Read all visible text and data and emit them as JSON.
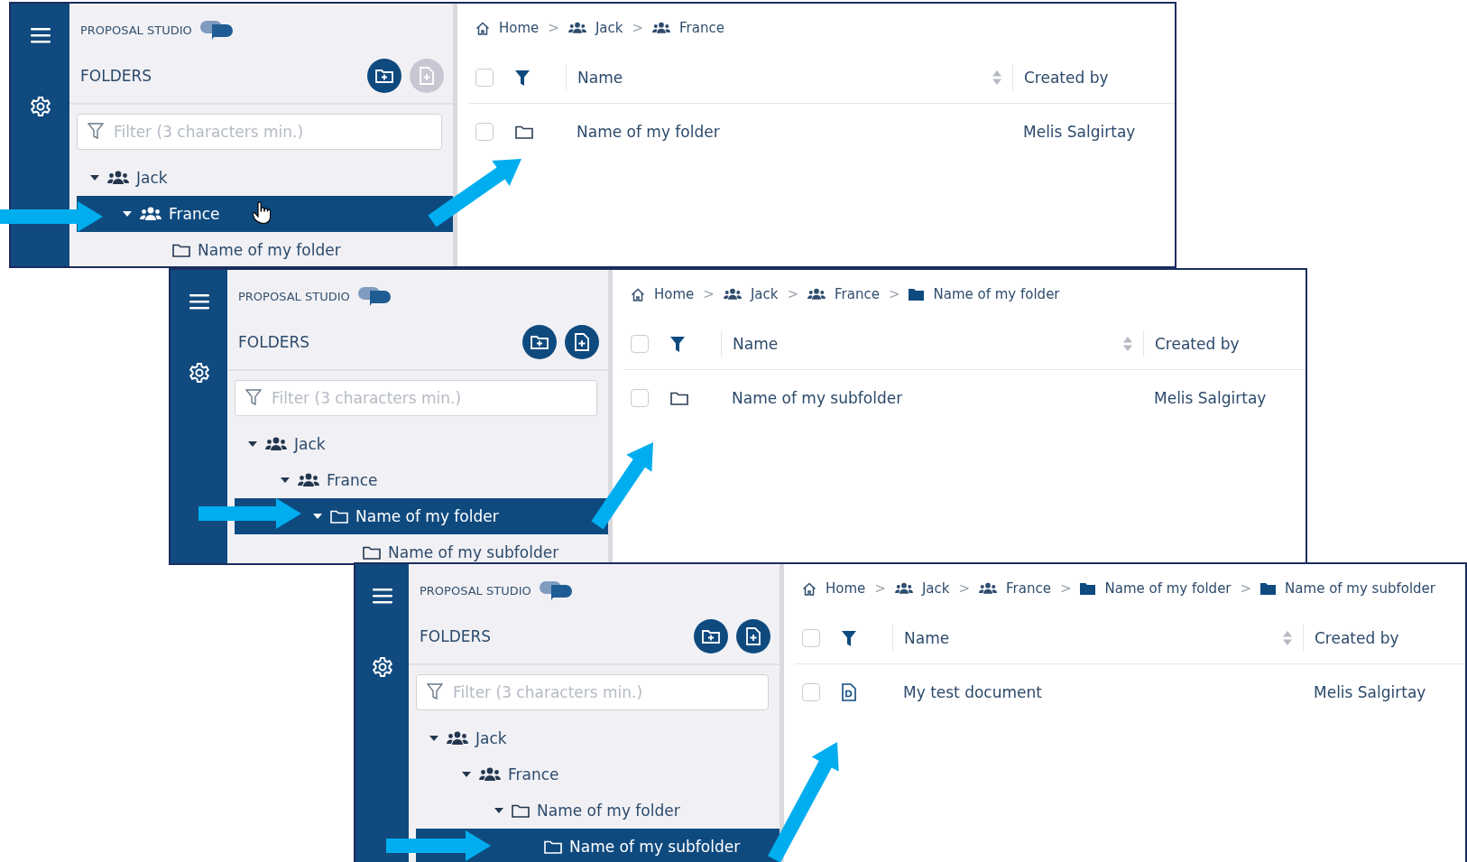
{
  "panels": [
    {
      "app_name": "PROPOSAL STUDIO",
      "section_title": "FOLDERS",
      "actions": [
        {
          "kind": "new-folder",
          "disabled": false
        },
        {
          "kind": "new-document",
          "disabled": true
        }
      ],
      "filter": {
        "placeholder": "Filter (3 characters min.)"
      },
      "tree": [
        {
          "label": "Jack",
          "kind": "group",
          "expanded": true,
          "selected": false,
          "children": [
            {
              "label": "France",
              "kind": "group",
              "expanded": true,
              "selected": true,
              "pointer": true,
              "children": [
                {
                  "label": "Name of my folder",
                  "kind": "folder",
                  "selected": false
                }
              ]
            }
          ]
        }
      ],
      "breadcrumb": [
        {
          "label": "Home",
          "kind": "home"
        },
        {
          "sep": ">",
          "label": "Jack",
          "kind": "group"
        },
        {
          "sep": ">",
          "label": "France",
          "kind": "group"
        }
      ],
      "columns": [
        "Name",
        "Created by"
      ],
      "all_checked": false,
      "rows": [
        {
          "kind": "folder",
          "name": "Name of my folder",
          "created_by": "Melis Salgirtay",
          "checked": false
        }
      ]
    },
    {
      "app_name": "PROPOSAL STUDIO",
      "section_title": "FOLDERS",
      "actions": [
        {
          "kind": "new-folder",
          "disabled": false
        },
        {
          "kind": "new-document",
          "disabled": false
        }
      ],
      "filter": {
        "placeholder": "Filter (3 characters min.)"
      },
      "tree": [
        {
          "label": "Jack",
          "kind": "group",
          "expanded": true,
          "selected": false,
          "children": [
            {
              "label": "France",
              "kind": "group",
              "expanded": true,
              "selected": false,
              "children": [
                {
                  "label": "Name of my folder",
                  "kind": "folder",
                  "expanded": true,
                  "selected": true,
                  "children": [
                    {
                      "label": "Name of my subfolder",
                      "kind": "folder",
                      "selected": false
                    }
                  ]
                }
              ]
            }
          ]
        }
      ],
      "breadcrumb": [
        {
          "label": "Home",
          "kind": "home"
        },
        {
          "sep": ">",
          "label": "Jack",
          "kind": "group"
        },
        {
          "sep": ">",
          "label": "France",
          "kind": "group"
        },
        {
          "sep": ">",
          "label": "Name of my folder",
          "kind": "folder"
        }
      ],
      "columns": [
        "Name",
        "Created by"
      ],
      "all_checked": false,
      "rows": [
        {
          "kind": "folder",
          "name": "Name of my subfolder",
          "created_by": "Melis Salgirtay",
          "checked": false
        }
      ]
    },
    {
      "app_name": "PROPOSAL STUDIO",
      "section_title": "FOLDERS",
      "actions": [
        {
          "kind": "new-folder",
          "disabled": false
        },
        {
          "kind": "new-document",
          "disabled": false
        }
      ],
      "filter": {
        "placeholder": "Filter (3 characters min.)"
      },
      "tree": [
        {
          "label": "Jack",
          "kind": "group",
          "expanded": true,
          "selected": false,
          "children": [
            {
              "label": "France",
              "kind": "group",
              "expanded": true,
              "selected": false,
              "children": [
                {
                  "label": "Name of my folder",
                  "kind": "folder",
                  "expanded": true,
                  "selected": false,
                  "children": [
                    {
                      "label": "Name of my subfolder",
                      "kind": "folder",
                      "selected": true
                    }
                  ]
                }
              ]
            }
          ]
        }
      ],
      "breadcrumb": [
        {
          "label": "Home",
          "kind": "home"
        },
        {
          "sep": ">",
          "label": "Jack",
          "kind": "group"
        },
        {
          "sep": ">",
          "label": "France",
          "kind": "group"
        },
        {
          "sep": ">",
          "label": "Name of my folder",
          "kind": "folder"
        },
        {
          "sep": ">",
          "label": "Name of my subfolder",
          "kind": "folder"
        }
      ],
      "columns": [
        "Name",
        "Created by"
      ],
      "all_checked": false,
      "rows": [
        {
          "kind": "document",
          "name": "My test document",
          "created_by": "Melis Salgirtay",
          "checked": false
        }
      ]
    }
  ]
}
